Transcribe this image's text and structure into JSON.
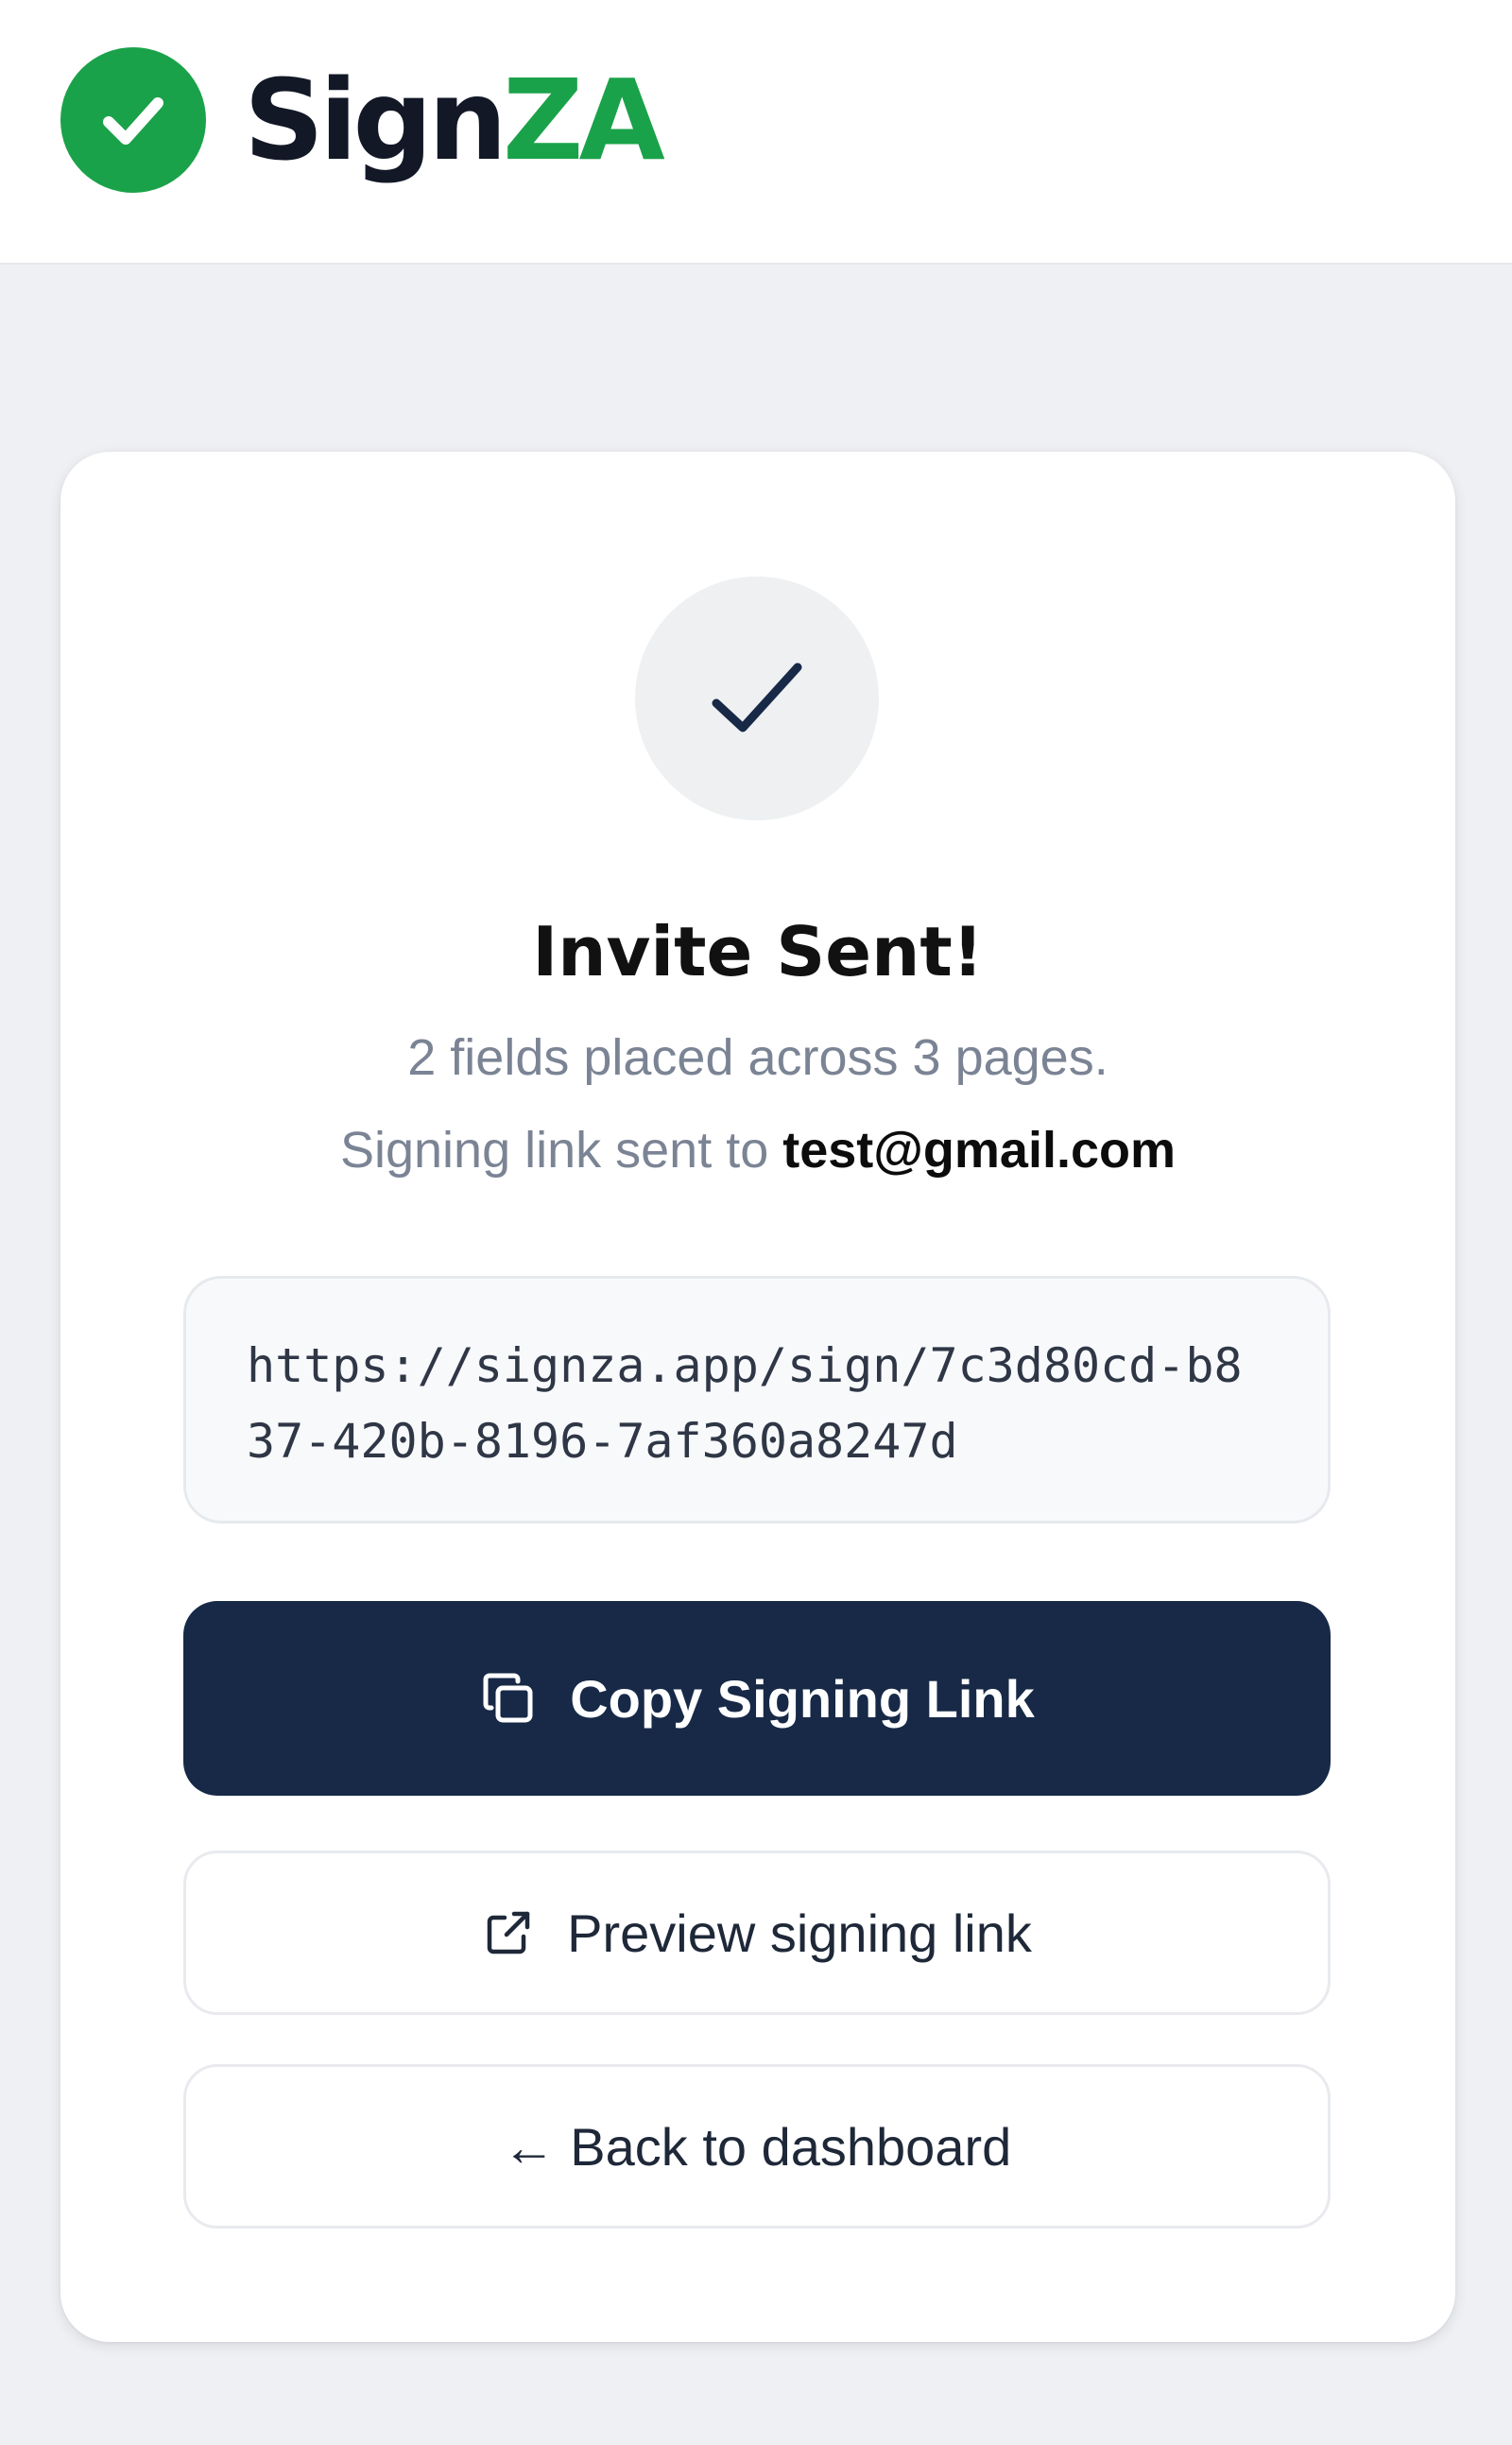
{
  "brand": {
    "name_dark": "Sign",
    "name_green": "ZA",
    "logo_icon": "check-circle-icon",
    "accent_color": "#1aa24a",
    "text_color": "#121826"
  },
  "status": {
    "icon": "check-icon",
    "title": "Invite Sent!",
    "summary": "2 fields placed across 3 pages.",
    "sent_to_prefix": "Signing link sent to ",
    "email": "test@gmail.com"
  },
  "signing_link": {
    "url": "https://signza.app/sign/7c3d80cd-b837-420b-8196-7af360a8247d"
  },
  "actions": {
    "copy_label": "Copy Signing Link",
    "copy_icon": "copy-icon",
    "preview_label": "Preview signing link",
    "preview_icon": "external-link-icon",
    "back_label": "← Back to dashboard"
  },
  "colors": {
    "primary_button": "#172947",
    "page_background": "#eff0f3",
    "muted_text": "#7b8494"
  }
}
